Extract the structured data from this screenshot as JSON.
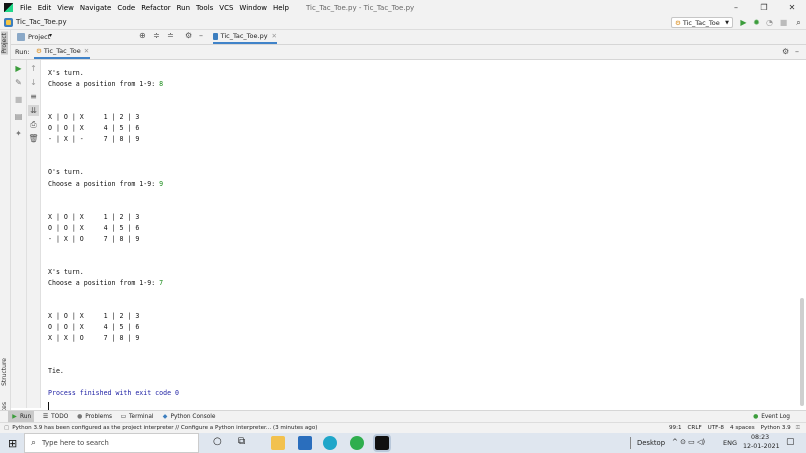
{
  "menubar": {
    "items": [
      "File",
      "Edit",
      "View",
      "Navigate",
      "Code",
      "Refactor",
      "Run",
      "Tools",
      "VCS",
      "Window",
      "Help"
    ],
    "window_title": "Tic_Tac_Toe.py - Tic_Tac_Toe.py",
    "minimize": "–",
    "maximize": "❐",
    "close": "✕"
  },
  "navbar": {
    "breadcrumb": "Tic_Tac_Toe.py",
    "run_config": "Tic_Tac_Toe"
  },
  "project_panel": {
    "label": "Project",
    "editor_tab": "Tic_Tac_Toe.py"
  },
  "left_strip": {
    "project": "Project",
    "structure": "Structure",
    "favorites": "Favorites"
  },
  "run_panel": {
    "label": "Run:",
    "tab": "Tic_Tac_Toe"
  },
  "console": {
    "lines": [
      {
        "text": "X's turn."
      },
      {
        "text": "Choose a position from 1-9: ",
        "input": "8"
      },
      {
        "text": ""
      },
      {
        "text": ""
      },
      {
        "text": "X | O | X     1 | 2 | 3"
      },
      {
        "text": "O | O | X     4 | 5 | 6"
      },
      {
        "text": "- | X | -     7 | 8 | 9"
      },
      {
        "text": ""
      },
      {
        "text": ""
      },
      {
        "text": "O's turn."
      },
      {
        "text": "Choose a position from 1-9: ",
        "input": "9"
      },
      {
        "text": ""
      },
      {
        "text": ""
      },
      {
        "text": "X | O | X     1 | 2 | 3"
      },
      {
        "text": "O | O | X     4 | 5 | 6"
      },
      {
        "text": "- | X | O     7 | 8 | 9"
      },
      {
        "text": ""
      },
      {
        "text": ""
      },
      {
        "text": "X's turn."
      },
      {
        "text": "Choose a position from 1-9: ",
        "input": "7"
      },
      {
        "text": ""
      },
      {
        "text": ""
      },
      {
        "text": "X | O | X     1 | 2 | 3"
      },
      {
        "text": "O | O | X     4 | 5 | 6"
      },
      {
        "text": "X | X | O     7 | 8 | 9"
      },
      {
        "text": ""
      },
      {
        "text": ""
      },
      {
        "text": "Tie."
      },
      {
        "text": ""
      },
      {
        "text": "Process finished with exit code 0",
        "style": "exit"
      }
    ]
  },
  "bottom_tabs": {
    "run": "Run",
    "todo": "TODO",
    "problems": "Problems",
    "terminal": "Terminal",
    "python_console": "Python Console",
    "event_log": "Event Log"
  },
  "status": {
    "message": "Python 3.9 has been configured as the project interpreter // Configure a Python interpreter... (3 minutes ago)",
    "position": "99:1",
    "line_sep": "CRLF",
    "encoding": "UTF-8",
    "indent": "4 spaces",
    "interpreter": "Python 3.9"
  },
  "taskbar": {
    "search_placeholder": "Type here to search",
    "desktop": "Desktop",
    "language": "ENG",
    "time": "08:23",
    "date": "12-01-2021"
  },
  "colors": {
    "console_input": "#178a17",
    "exit_text": "#1d1fa3",
    "active_tab_underline": "#4083c9"
  }
}
